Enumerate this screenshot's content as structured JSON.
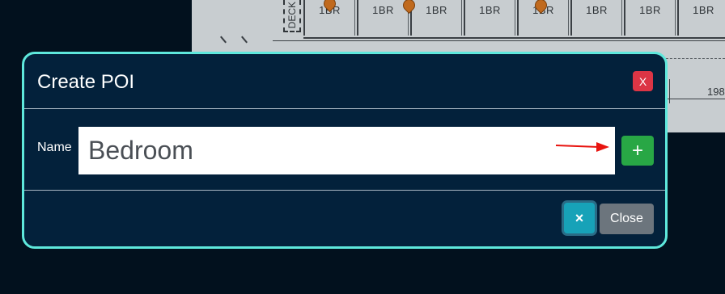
{
  "background": {
    "deck_label": "DECK",
    "units": [
      "1BR",
      "1BR",
      "1BR",
      "1BR",
      "1BR",
      "1BR",
      "1BR",
      "1BR"
    ],
    "dimension_text": "198"
  },
  "modal": {
    "title": "Create POI",
    "header_close_label": "X",
    "name_label": "Name",
    "name_value": "Bedroom",
    "add_label": "+",
    "clear_label": "×",
    "close_label": "Close",
    "colors": {
      "border": "#5ee8dc",
      "background": "#03213b",
      "danger": "#dc3545",
      "success": "#28a745",
      "info": "#17a2b8",
      "secondary": "#6c757d",
      "annotation_arrow": "#e8140f"
    }
  }
}
